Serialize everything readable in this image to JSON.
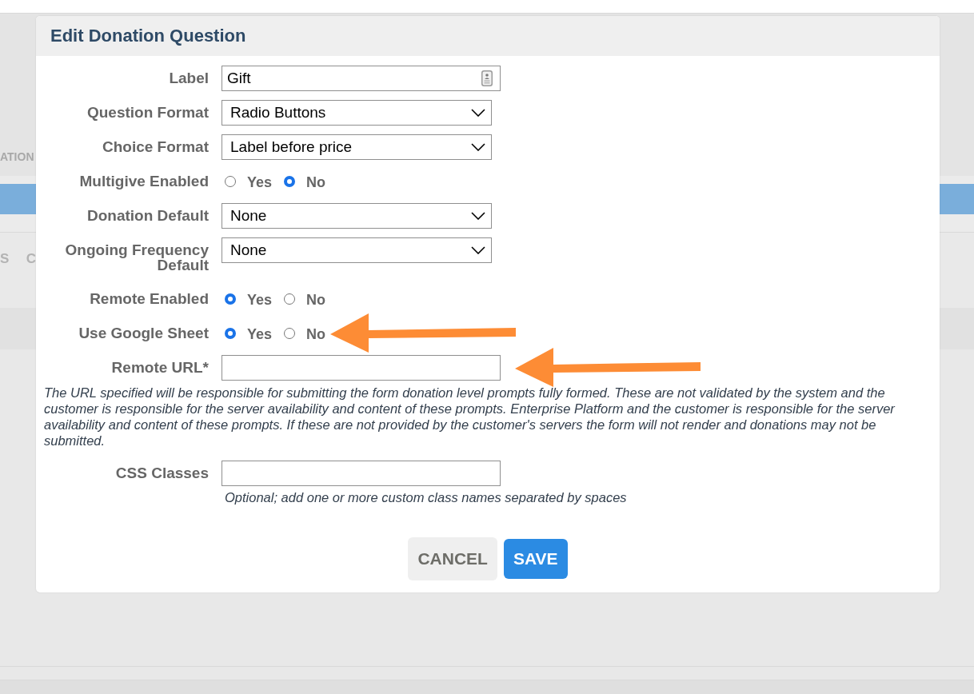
{
  "background": {
    "heading_fragment": "ATION",
    "tab_fragments": [
      "S",
      "C"
    ]
  },
  "dialog": {
    "title": "Edit Donation Question",
    "fields": [
      {
        "kind": "text",
        "label": "Label",
        "value": "Gift",
        "icon": true
      },
      {
        "kind": "select",
        "label": "Question Format",
        "value": "Radio Buttons"
      },
      {
        "kind": "select",
        "label": "Choice Format",
        "value": "Label before price"
      },
      {
        "kind": "radio",
        "label": "Multigive Enabled",
        "options": [
          {
            "label": "Yes",
            "selected": false
          },
          {
            "label": "No",
            "selected": true
          }
        ]
      },
      {
        "kind": "select",
        "label": "Donation Default",
        "value": "None"
      },
      {
        "kind": "select",
        "label": "Ongoing Frequency Default",
        "value": "None"
      },
      {
        "kind": "radio",
        "label": "Remote Enabled",
        "options": [
          {
            "label": "Yes",
            "selected": true
          },
          {
            "label": "No",
            "selected": false
          }
        ]
      },
      {
        "kind": "radio",
        "label": "Use Google Sheet",
        "options": [
          {
            "label": "Yes",
            "selected": true
          },
          {
            "label": "No",
            "selected": false
          }
        ],
        "arrow": true
      },
      {
        "kind": "text",
        "label": "Remote URL*",
        "arrow": true
      },
      {
        "kind": "note",
        "text": "The URL specified will be responsible for submitting the form donation level prompts fully formed. These are not validated by the system and the customer is responsible for the server availability and content of these prompts. Enterprise Platform and the customer is responsible for the server availability and content of these prompts. If these are not provided by the customer's servers the form will not render and donations may not be submitted."
      },
      {
        "kind": "text",
        "label": "CSS Classes",
        "hint": "Optional; add one or more custom class names separated by spaces"
      }
    ],
    "buttons": [
      {
        "kind": "secondary",
        "label": "CANCEL"
      },
      {
        "kind": "primary",
        "label": "SAVE"
      }
    ]
  }
}
